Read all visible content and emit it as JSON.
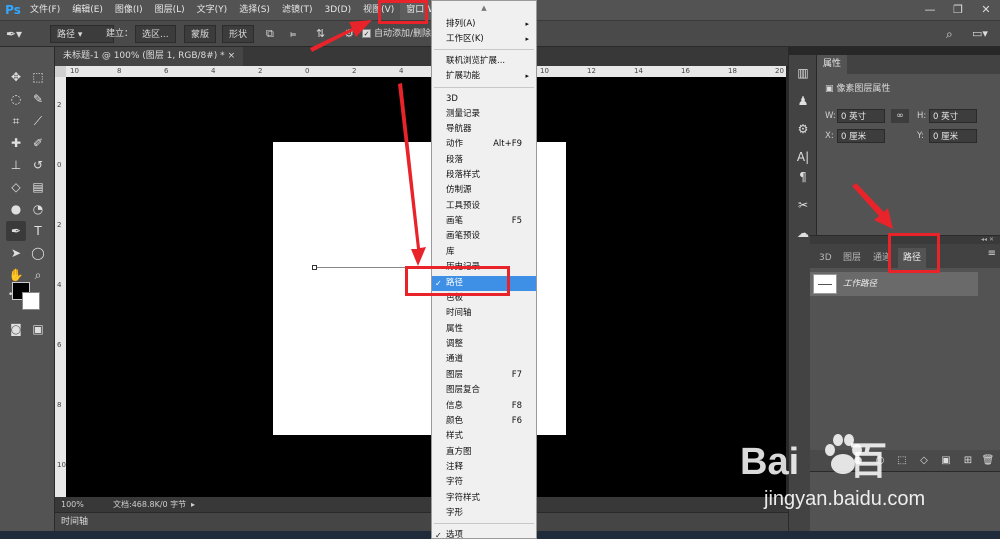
{
  "menubar": {
    "logo": "Ps",
    "items": [
      "文件(F)",
      "编辑(E)",
      "图像(I)",
      "图层(L)",
      "文字(Y)",
      "选择(S)",
      "滤镜(T)",
      "3D(D)",
      "视图(V)",
      "窗口(W)"
    ],
    "window_controls": [
      "—",
      "❐",
      "✕"
    ]
  },
  "optionsbar": {
    "mode": "路径",
    "make_label": "建立：",
    "btn_selection": "选区...",
    "btn_mask": "蒙版",
    "btn_shape": "形状",
    "auto_add": "自动添加/删除"
  },
  "document": {
    "tab_title": "未标题-1 @ 100% (图层 1, RGB/8#) *",
    "tab_close": "×",
    "zoom": "100%",
    "doc_info": "文档:468.8K/0 字节",
    "ruler_top": [
      "10",
      "8",
      "6",
      "4",
      "2",
      "0",
      "2",
      "4",
      "6",
      "8",
      "10",
      "12",
      "14",
      "16",
      "18",
      "20"
    ],
    "ruler_left": [
      "2",
      "0",
      "2",
      "4",
      "6",
      "8",
      "10"
    ]
  },
  "timeline": {
    "label": "时间轴"
  },
  "dropdown": {
    "items": [
      {
        "label": "排列(A)",
        "submenu": true
      },
      {
        "label": "工作区(K)",
        "submenu": true
      },
      {
        "label": "联机浏览扩展..."
      },
      {
        "label": "扩展功能",
        "submenu": true
      },
      {
        "label": "3D"
      },
      {
        "label": "测量记录"
      },
      {
        "label": "导航器"
      },
      {
        "label": "动作",
        "shortcut": "Alt+F9"
      },
      {
        "label": "段落"
      },
      {
        "label": "段落样式"
      },
      {
        "label": "仿制源"
      },
      {
        "label": "工具预设"
      },
      {
        "label": "画笔",
        "shortcut": "F5"
      },
      {
        "label": "画笔预设"
      },
      {
        "label": "库"
      },
      {
        "label": "历史记录"
      },
      {
        "label": "路径",
        "checked": true,
        "highlighted": true
      },
      {
        "label": "色板"
      },
      {
        "label": "时间轴"
      },
      {
        "label": "属性"
      },
      {
        "label": "调整"
      },
      {
        "label": "通道"
      },
      {
        "label": "图层",
        "shortcut": "F7"
      },
      {
        "label": "图层复合"
      },
      {
        "label": "信息",
        "shortcut": "F8"
      },
      {
        "label": "颜色",
        "shortcut": "F6"
      },
      {
        "label": "样式"
      },
      {
        "label": "直方图"
      },
      {
        "label": "注释"
      },
      {
        "label": "字符"
      },
      {
        "label": "字符样式"
      },
      {
        "label": "字形"
      },
      {
        "label": "选项",
        "checked": true
      }
    ]
  },
  "properties": {
    "tab": "属性",
    "subtitle": "像素图层属性",
    "w_label": "W:",
    "w_value": "0 英寸",
    "h_label": "H:",
    "h_value": "0 英寸",
    "x_label": "X:",
    "x_value": "0 厘米",
    "y_label": "Y:",
    "y_value": "0 厘米"
  },
  "paths_panel": {
    "tabs": [
      "3D",
      "图层",
      "通道",
      "路径"
    ],
    "active_tab": "路径",
    "path_name": "工作路径",
    "collapse": "◂◂ ✕"
  },
  "watermark": {
    "logo_left": "Bai",
    "logo_right": "百",
    "url": "jingyan.baidu.com"
  },
  "colors": {
    "accent": "#e8232a",
    "highlight": "#3e8fe6",
    "ps_blue": "#31a8ff"
  }
}
